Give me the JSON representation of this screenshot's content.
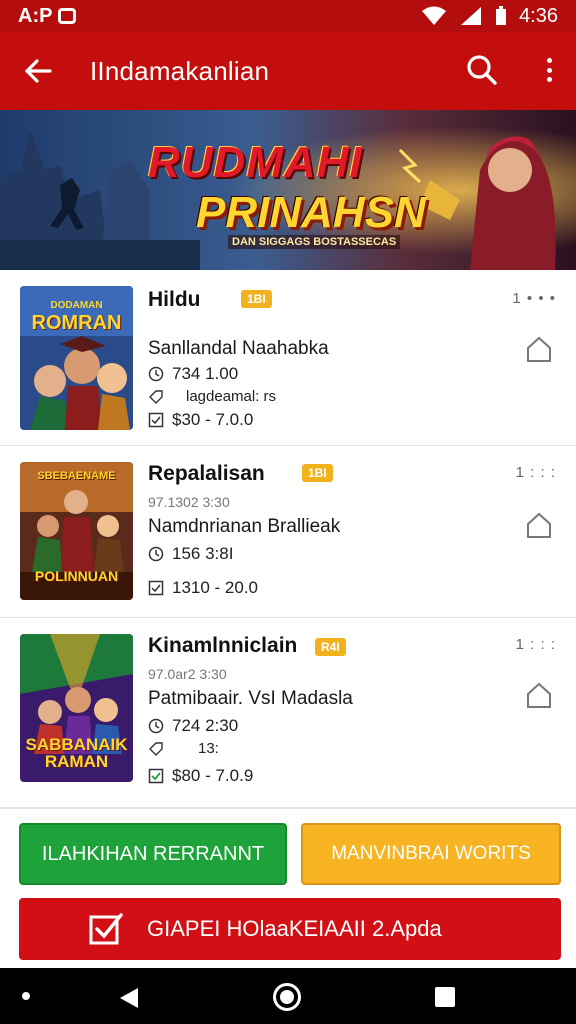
{
  "status_bar": {
    "left_text": "A:P",
    "time": "4:36"
  },
  "app_bar": {
    "title": "IIndamakanlian"
  },
  "banner": {
    "title": "RUDMAHI",
    "subtitle": "PRINAHSN",
    "tagline": "DAN SIGGAGS BOSTASSECAS"
  },
  "items": [
    {
      "thumb_label": "ROMRAN",
      "thumb_top": "DODAMAN",
      "name": "Hildu",
      "badge": "1BI",
      "sub": "",
      "count": "1 • • •",
      "desc": "Sanllandal Naahabka",
      "line1": "734 1.00",
      "line2": "lagdeamal: rs",
      "line3": "$30 - 7.0.0"
    },
    {
      "thumb_label": "POLINNUAN",
      "thumb_top": "SBEBAENAME",
      "name": "Repalalisan",
      "badge": "1BI",
      "sub": "97.1302 3:30",
      "count": "1 : : :",
      "desc": "Namdnrianan Brallieak",
      "line1": "156 3:8I",
      "line2": "",
      "line3": "1310 - 20.0"
    },
    {
      "thumb_label": "SABBANAIK RAMAN",
      "thumb_top": "",
      "name": "Kinamlnniclain",
      "badge": "R4I",
      "sub": "97.0ar2 3:30",
      "count": "1 : : :",
      "desc": "Patmibaair. VsI Madasla",
      "line1": "724 2:30",
      "line2": "13:",
      "line3": "$80 - 7.0.9"
    }
  ],
  "actions": {
    "green_label": "ILAHKIHAN RERRANNT",
    "yellow_label": "MANVINBRAI WORITS",
    "primary_label": "GIAPEI HOlaaKEIAAII 2.Apda"
  },
  "colors": {
    "primary_red": "#c40e0e",
    "accent_green": "#1ea33b",
    "accent_yellow": "#f7b321",
    "badge": "#f2b21d"
  },
  "icons": {
    "back": "arrow-left-icon",
    "search": "search-icon",
    "more": "more-vert-icon",
    "favorite": "home-outline-icon",
    "primary": "checklist-icon"
  }
}
